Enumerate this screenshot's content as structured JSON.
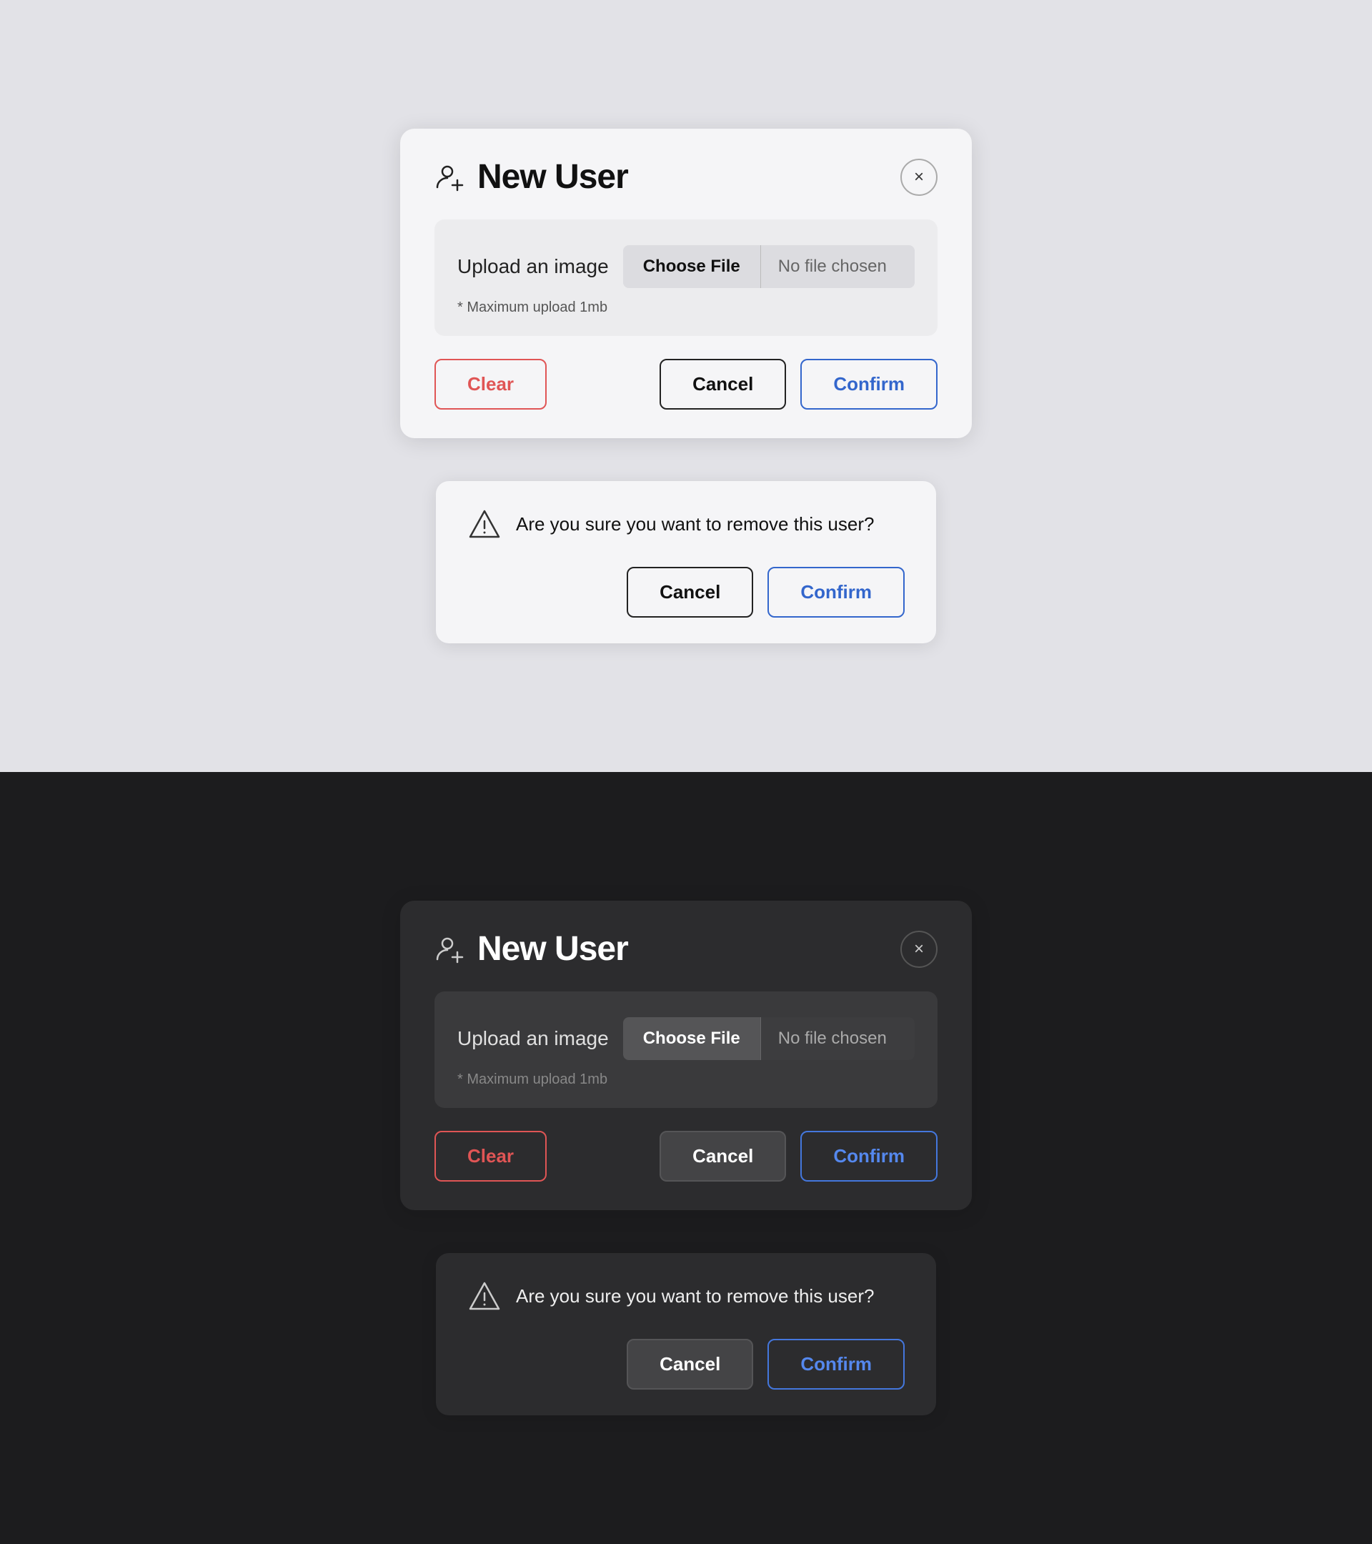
{
  "light": {
    "theme": "light",
    "modal": {
      "title": "New User",
      "close_label": "×",
      "upload_label": "Upload an image",
      "choose_file_label": "Choose File",
      "no_file_label": "No file chosen",
      "max_upload_note": "* Maximum upload 1mb",
      "clear_label": "Clear",
      "cancel_label": "Cancel",
      "confirm_label": "Confirm"
    },
    "confirm_dialog": {
      "message": "Are you sure you want to remove this user?",
      "cancel_label": "Cancel",
      "confirm_label": "Confirm"
    }
  },
  "dark": {
    "theme": "dark",
    "modal": {
      "title": "New User",
      "close_label": "×",
      "upload_label": "Upload an image",
      "choose_file_label": "Choose File",
      "no_file_label": "No file chosen",
      "max_upload_note": "* Maximum upload 1mb",
      "clear_label": "Clear",
      "cancel_label": "Cancel",
      "confirm_label": "Confirm"
    },
    "confirm_dialog": {
      "message": "Are you sure you want to remove this user?",
      "cancel_label": "Cancel",
      "confirm_label": "Confirm"
    }
  }
}
